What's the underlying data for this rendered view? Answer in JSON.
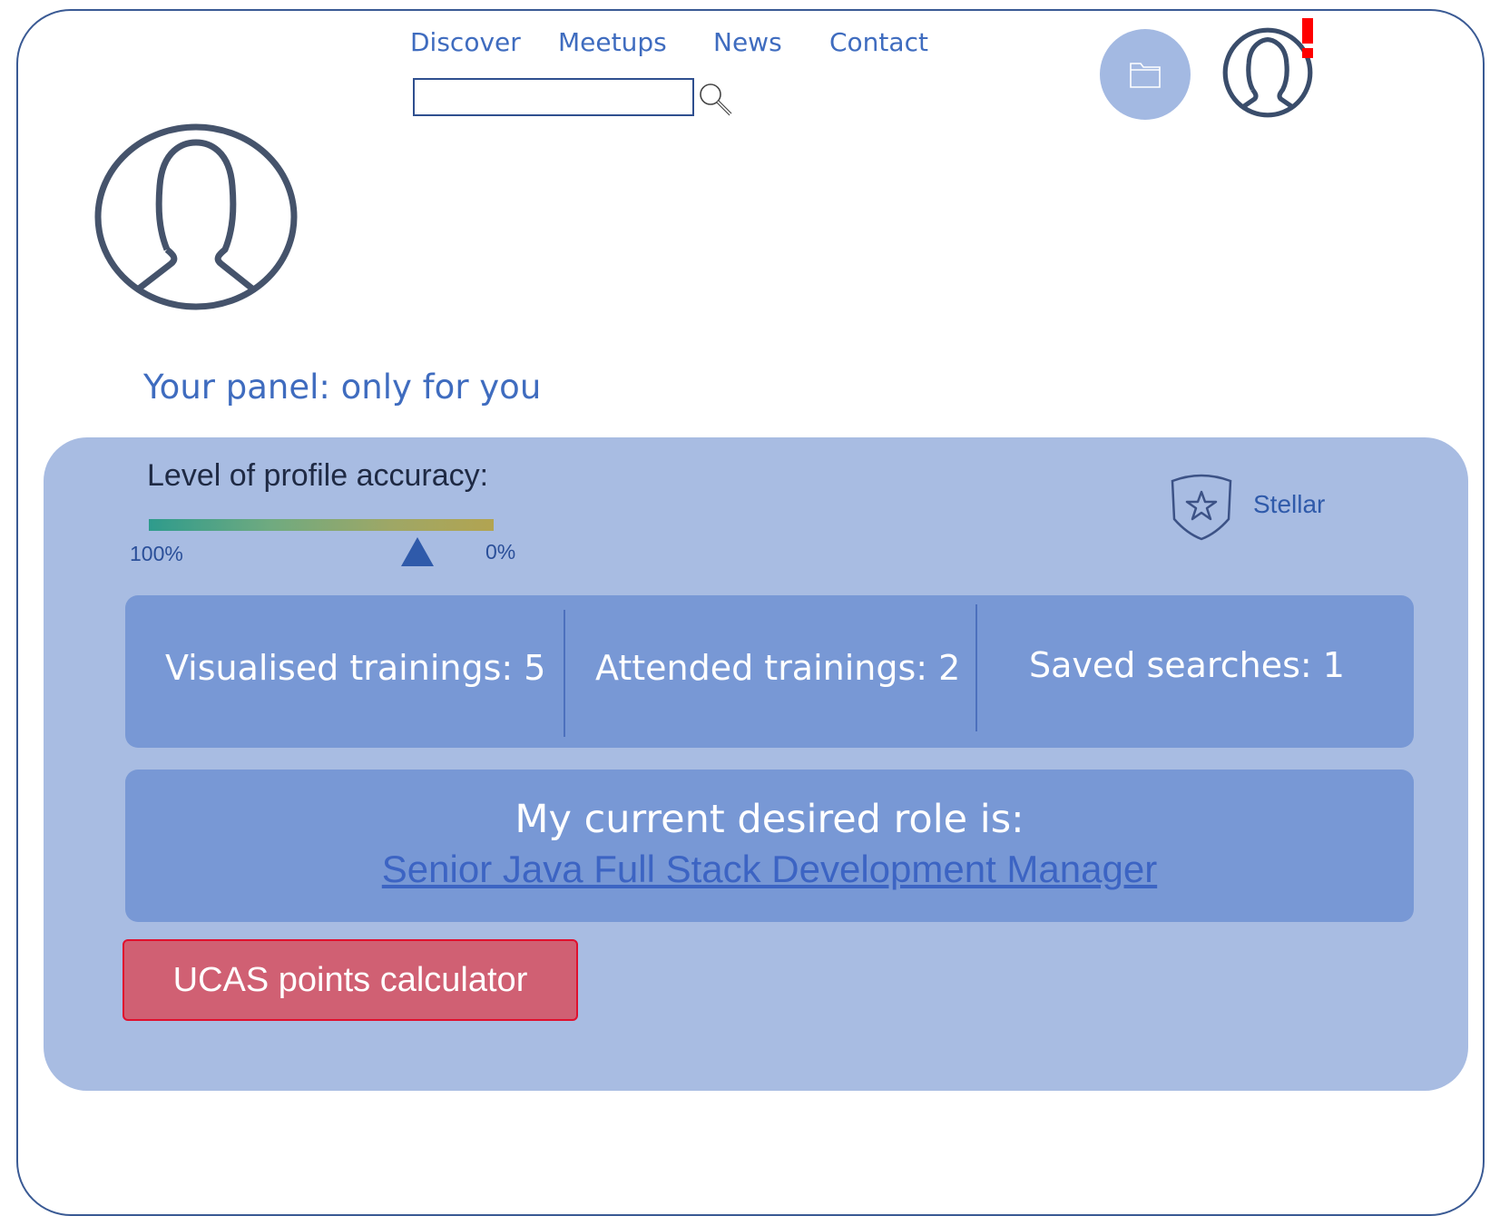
{
  "nav": {
    "items": [
      "Discover",
      "Meetups",
      "News",
      "Contact"
    ]
  },
  "search": {
    "value": "",
    "placeholder": ""
  },
  "icons": {
    "search": "search-icon",
    "folder": "folder-icon",
    "notification_avatar": "user-avatar-icon",
    "notification_mark": "alert-exclamation-icon",
    "profile_avatar": "user-avatar-icon",
    "badge": "shield-star-icon",
    "marker": "triangle-marker-icon"
  },
  "panel": {
    "heading": "Your panel: only for you",
    "accuracy": {
      "title": "Level of profile accuracy:",
      "scale_high": "100%",
      "scale_low": "0%",
      "marker_fraction_from_left": 0.78
    },
    "badge": {
      "label": "Stellar"
    },
    "stats": [
      {
        "label": "Visualised trainings: 5"
      },
      {
        "label": "Attended trainings: 2"
      },
      {
        "label": "Saved searches: 1"
      }
    ],
    "role": {
      "title": "My current desired role is:",
      "link": "Senior Java Full Stack Development Manager"
    },
    "ucas_button": "UCAS points calculator"
  },
  "colors": {
    "accent": "#3f6cbf",
    "panel_bg": "#a8bce2",
    "box_bg": "#7898d5",
    "button_bg": "#d06073",
    "button_border": "#e0102e",
    "alert": "#ff0000"
  }
}
